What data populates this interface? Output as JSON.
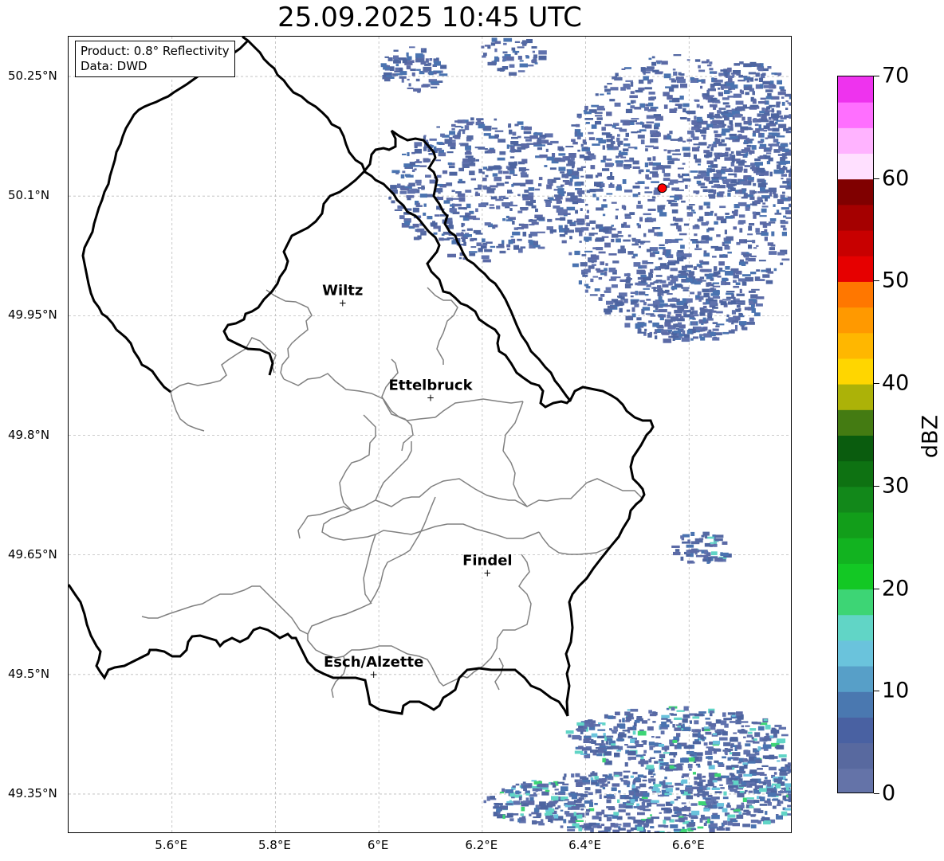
{
  "title": "25.09.2025 10:45 UTC",
  "info": {
    "product": "Product: 0.8° Reflectivity",
    "data": "Data: DWD"
  },
  "lat_ticks": [
    "50.25°N",
    "50.1°N",
    "49.95°N",
    "49.8°N",
    "49.65°N",
    "49.5°N",
    "49.35°N"
  ],
  "lon_ticks": [
    "5.6°E",
    "5.8°E",
    "6°E",
    "6.2°E",
    "6.4°E",
    "6.6°E"
  ],
  "cities": [
    {
      "name": "Wiltz",
      "lon": 5.93,
      "lat": 49.966
    },
    {
      "name": "Ettelbruck",
      "lon": 6.1,
      "lat": 49.847
    },
    {
      "name": "Findel",
      "lon": 6.21,
      "lat": 49.627
    },
    {
      "name": "Esch/Alzette",
      "lon": 5.99,
      "lat": 49.5
    }
  ],
  "radar_site": {
    "lon": 6.548,
    "lat": 50.11,
    "color": "#ff0000"
  },
  "colorbar": {
    "label": "dBZ",
    "min": 0,
    "max": 70,
    "step": 2.5,
    "tick_labels": [
      "70",
      "60",
      "50",
      "40",
      "30",
      "20",
      "10",
      "0"
    ],
    "colors": [
      "#6473a8",
      "#58699f",
      "#4961a2",
      "#4a78b0",
      "#579fc8",
      "#6ac3dc",
      "#61d5c6",
      "#3dd575",
      "#13c824",
      "#12b320",
      "#129e1a",
      "#12881a",
      "#0e7212",
      "#0a5c0e",
      "#447b12",
      "#acb208",
      "#ffd600",
      "#ffb700",
      "#ff9900",
      "#ff7700",
      "#e60000",
      "#c80000",
      "#a50000",
      "#800000",
      "#ffe0ff",
      "#ffb3ff",
      "#ff6fff",
      "#ee33ee"
    ]
  },
  "map_extent": {
    "lon_min": 5.4,
    "lon_max": 6.8,
    "lat_min": 49.3,
    "lat_max": 50.3
  }
}
